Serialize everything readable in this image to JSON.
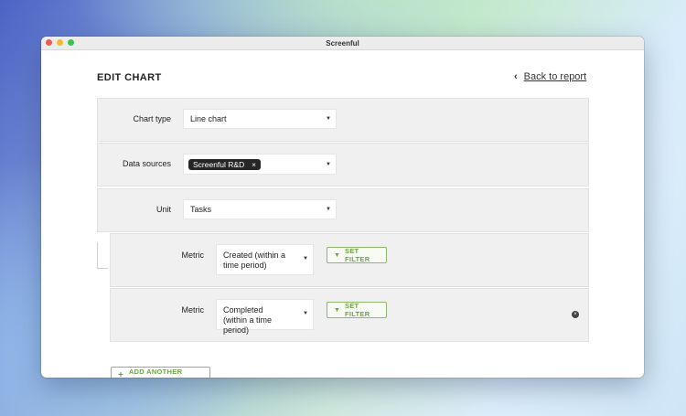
{
  "window": {
    "title": "Screenful"
  },
  "header": {
    "title": "EDIT CHART",
    "back_label": "Back to report"
  },
  "form": {
    "chart_type": {
      "label": "Chart type",
      "value": "Line chart"
    },
    "data_sources": {
      "label": "Data sources",
      "chips": [
        "Screenful R&D"
      ]
    },
    "unit": {
      "label": "Unit",
      "value": "Tasks"
    },
    "metrics": [
      {
        "label": "Metric",
        "value": "Created (within a time period)",
        "filter_label": "SET FILTER"
      },
      {
        "label": "Metric",
        "value": "Completed (within a time period)",
        "filter_label": "SET FILTER"
      }
    ],
    "add_metric_label": "ADD ANOTHER METRIC"
  },
  "colors": {
    "accent": "#6fa14a",
    "panel_bg": "#f0f0f0",
    "chip_bg": "#262626"
  }
}
